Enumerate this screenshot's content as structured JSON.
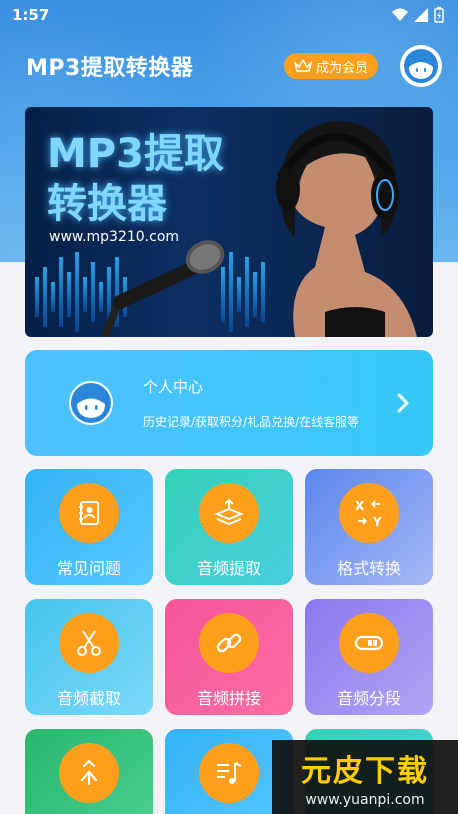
{
  "status": {
    "time": "1:57"
  },
  "header": {
    "title": "MP3提取转换器",
    "vip_label": "成为会员"
  },
  "banner": {
    "line1": "MP3提取",
    "line2": "转换器",
    "url": "www.mp3210.com"
  },
  "profile": {
    "title": "个人中心",
    "subtitle": "历史记录/获取积分/礼品兑换/在线客服等"
  },
  "tiles": [
    {
      "label": "常见问题",
      "icon": "faq-book-icon"
    },
    {
      "label": "音频提取",
      "icon": "extract-layers-icon"
    },
    {
      "label": "格式转换",
      "icon": "format-convert-icon"
    },
    {
      "label": "音频截取",
      "icon": "scissors-icon"
    },
    {
      "label": "音频拼接",
      "icon": "link-icon"
    },
    {
      "label": "音频分段",
      "icon": "segment-icon"
    },
    {
      "label": "",
      "icon": "merge-arrow-icon"
    },
    {
      "label": "",
      "icon": "music-list-icon"
    },
    {
      "label": "",
      "icon": ""
    }
  ],
  "watermark": {
    "logo": "元皮下载",
    "url": "www.yuanpi.com"
  },
  "colors": {
    "primary": "#3a8fe0",
    "accent": "#ff9f1c"
  }
}
